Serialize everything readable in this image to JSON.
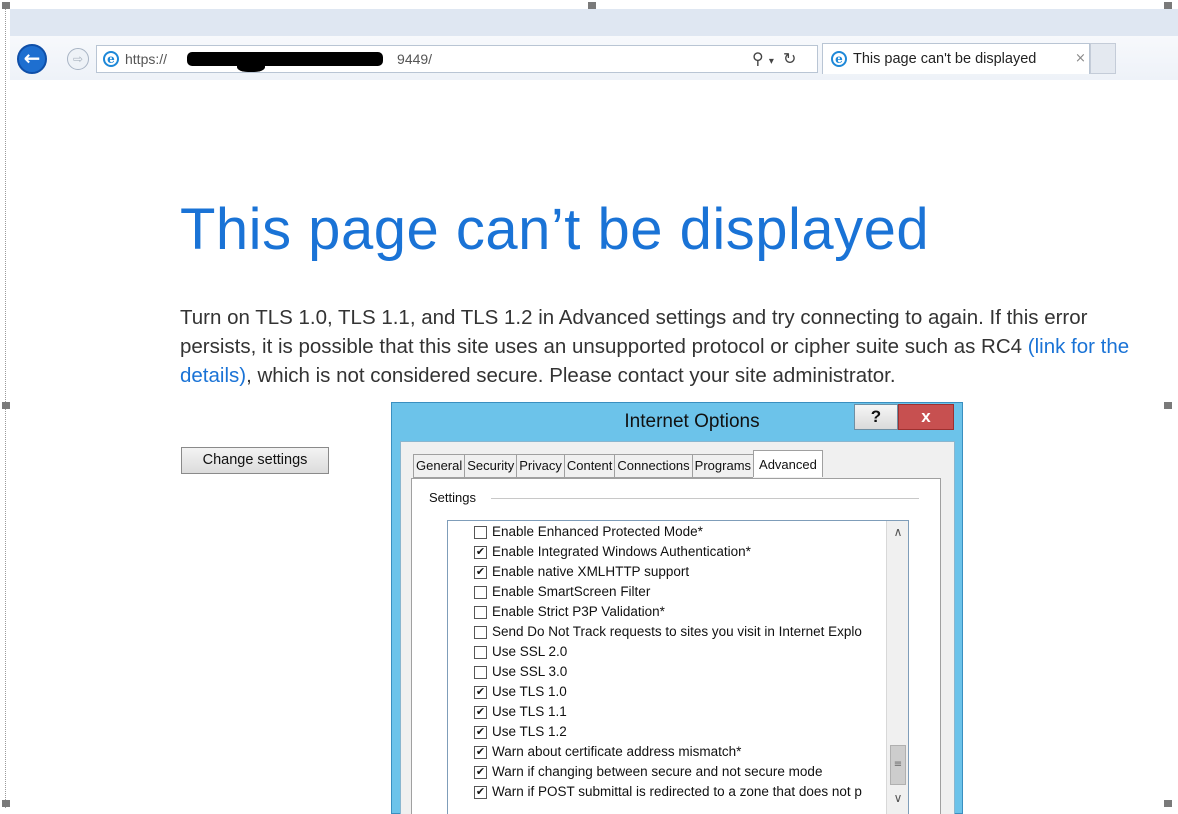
{
  "browser": {
    "url": "https://",
    "url_tail": "9449/",
    "search_icon": "search-icon",
    "dropdown_icon": "chevron-down-icon",
    "refresh_icon": "refresh-icon",
    "tab_title": "This page can't be displayed",
    "tab_close": "×"
  },
  "page": {
    "heading": "This page can’t be displayed",
    "message_part1": "Turn on TLS 1.0, TLS 1.1, and TLS 1.2 in Advanced settings and try connecting to again. If this error persists, it is possible that this site uses an unsupported protocol or cipher suite such as RC4 ",
    "message_link": "(link for the details)",
    "message_part2": ", which is not considered secure. Please contact your site administrator.",
    "change_settings_button": "Change settings"
  },
  "dialog": {
    "title": "Internet Options",
    "help_label": "?",
    "close_label": "x",
    "tabs": [
      "General",
      "Security",
      "Privacy",
      "Content",
      "Connections",
      "Programs",
      "Advanced"
    ],
    "active_tab": "Advanced",
    "settings_label": "Settings",
    "items": [
      {
        "label": "Enable Enhanced Protected Mode*",
        "checked": false
      },
      {
        "label": "Enable Integrated Windows Authentication*",
        "checked": true
      },
      {
        "label": "Enable native XMLHTTP support",
        "checked": true
      },
      {
        "label": "Enable SmartScreen Filter",
        "checked": false
      },
      {
        "label": "Enable Strict P3P Validation*",
        "checked": false
      },
      {
        "label": "Send Do Not Track requests to sites you visit in Internet Explo",
        "checked": false
      },
      {
        "label": "Use SSL 2.0",
        "checked": false
      },
      {
        "label": "Use SSL 3.0",
        "checked": false
      },
      {
        "label": "Use TLS 1.0",
        "checked": true
      },
      {
        "label": "Use TLS 1.1",
        "checked": true
      },
      {
        "label": "Use TLS 1.2",
        "checked": true
      },
      {
        "label": "Warn about certificate address mismatch*",
        "checked": true
      },
      {
        "label": "Warn if changing between secure and not secure mode",
        "checked": true
      },
      {
        "label": "Warn if POST submittal is redirected to a zone that does not p",
        "checked": true
      }
    ]
  },
  "colors": {
    "heading": "#1a73d6",
    "link": "#1a73d6",
    "dialog_frame": "#6cc3ea",
    "close_button": "#c75050"
  }
}
